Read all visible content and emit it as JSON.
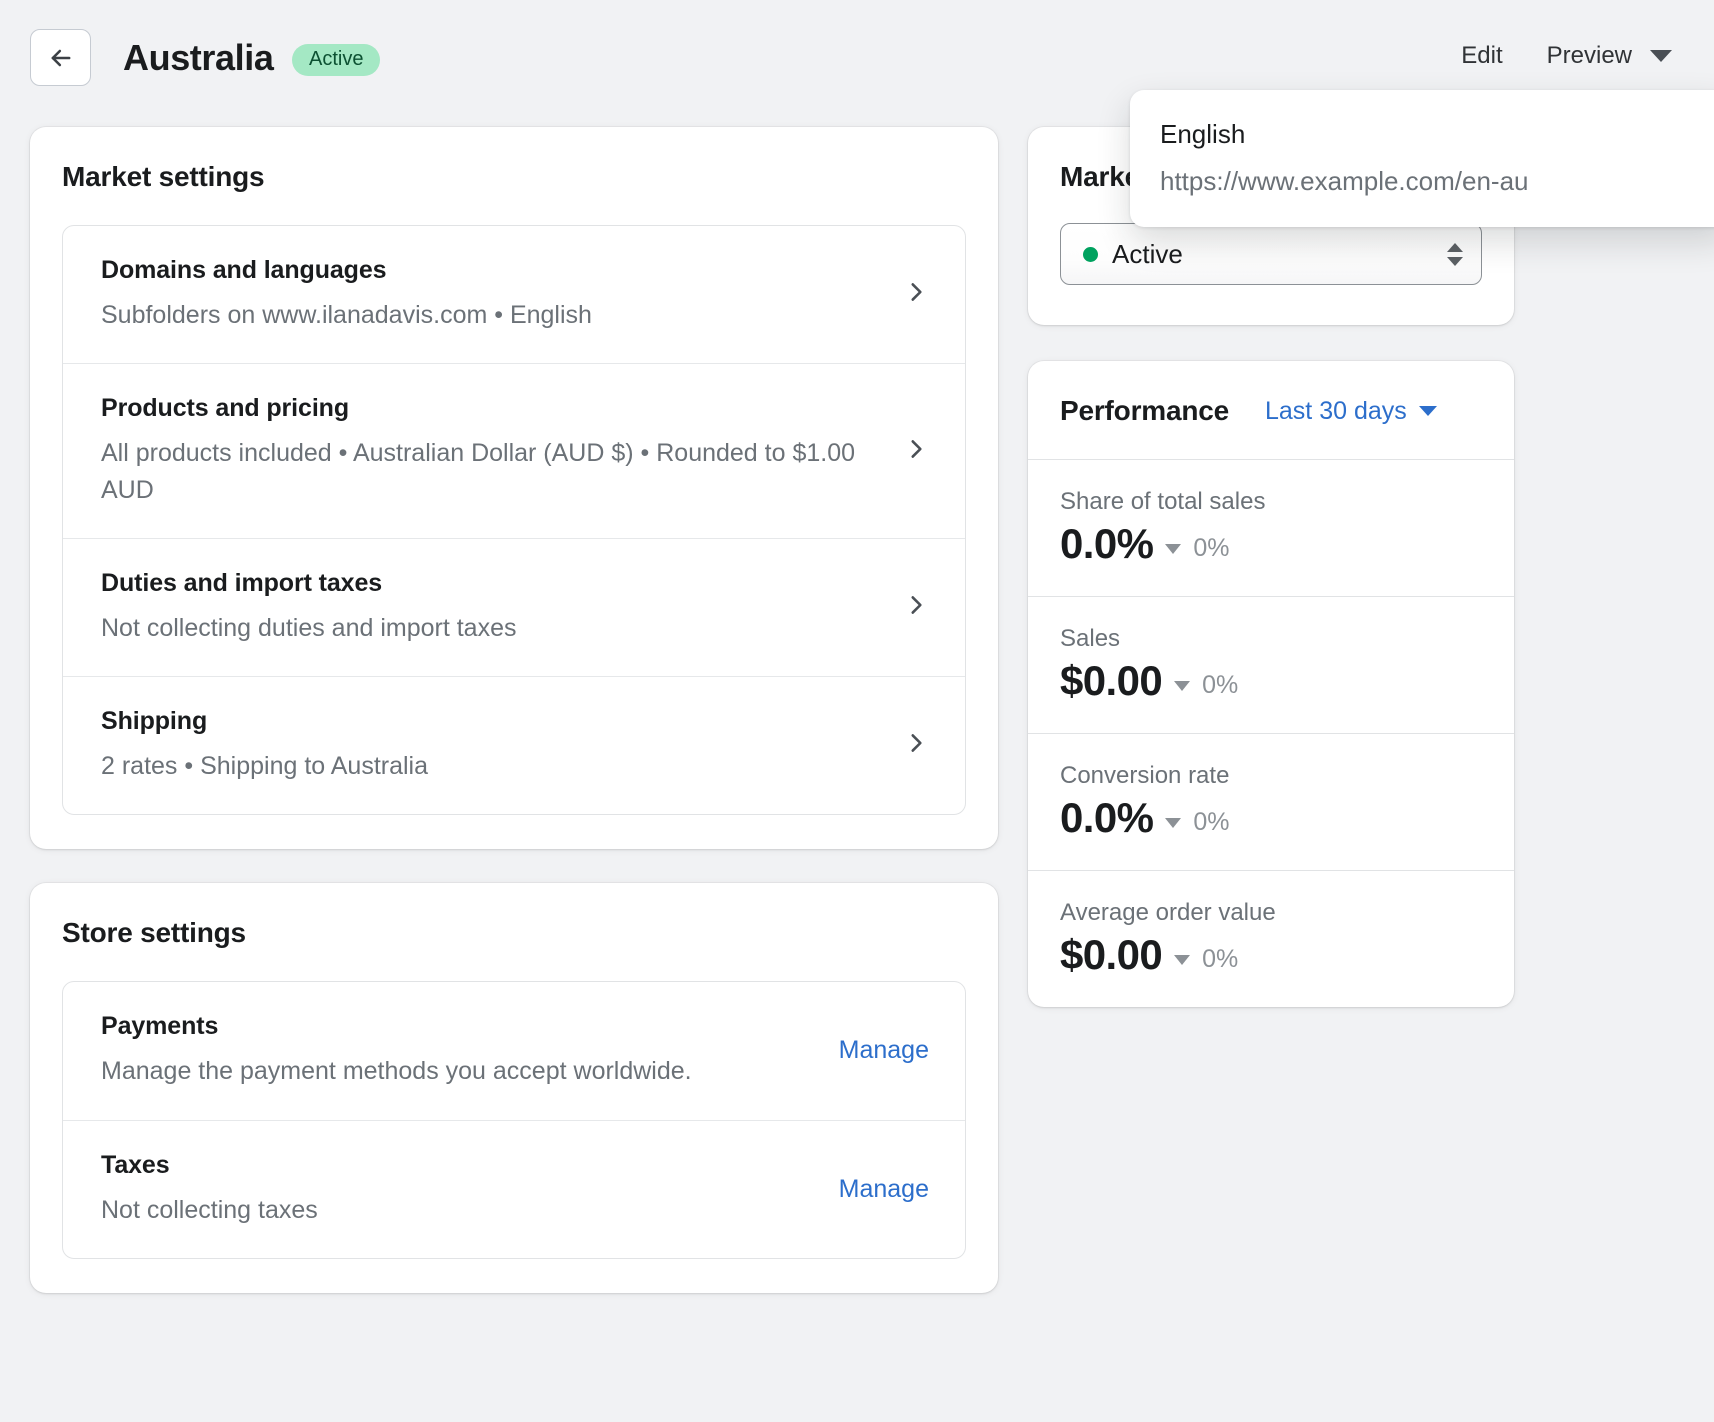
{
  "header": {
    "back_icon": "arrow-left-icon",
    "title": "Australia",
    "status_badge": "Active",
    "edit_label": "Edit",
    "preview_label": "Preview",
    "preview_caret_icon": "chevron-down-icon"
  },
  "preview_popover": {
    "language": "English",
    "url": "https://www.example.com/en-au"
  },
  "market_settings": {
    "title": "Market settings",
    "rows": [
      {
        "title": "Domains and languages",
        "subtitle": "Subfolders on www.ilanadavis.com • English",
        "chevron_icon": "chevron-right-icon"
      },
      {
        "title": "Products and pricing",
        "subtitle": "All products included • Australian Dollar (AUD $) • Rounded to $1.00 AUD",
        "chevron_icon": "chevron-right-icon"
      },
      {
        "title": "Duties and import taxes",
        "subtitle": "Not collecting duties and import taxes",
        "chevron_icon": "chevron-right-icon"
      },
      {
        "title": "Shipping",
        "subtitle": "2 rates • Shipping to Australia",
        "chevron_icon": "chevron-right-icon"
      }
    ]
  },
  "store_settings": {
    "title": "Store settings",
    "rows": [
      {
        "title": "Payments",
        "subtitle": "Manage the payment methods you accept worldwide.",
        "action_label": "Manage"
      },
      {
        "title": "Taxes",
        "subtitle": "Not collecting taxes",
        "action_label": "Manage"
      }
    ]
  },
  "market_status": {
    "title": "Market status",
    "select_value": "Active",
    "dot_color": "#00a25f",
    "stepper_icon": "select-stepper-icon"
  },
  "performance": {
    "title": "Performance",
    "range_label": "Last 30 days",
    "range_caret_icon": "chevron-down-icon",
    "metrics": [
      {
        "label": "Share of total sales",
        "value": "0.0%",
        "delta": "0%",
        "delta_caret_icon": "caret-down-icon",
        "has_sparkline": true
      },
      {
        "label": "Sales",
        "value": "$0.00",
        "delta": "0%",
        "delta_caret_icon": "caret-down-icon",
        "has_sparkline": true
      },
      {
        "label": "Conversion rate",
        "value": "0.0%",
        "delta": "0%",
        "delta_caret_icon": "caret-down-icon",
        "has_sparkline": false
      },
      {
        "label": "Average order value",
        "value": "$0.00",
        "delta": "0%",
        "delta_caret_icon": "caret-down-icon",
        "has_sparkline": false
      }
    ]
  },
  "colors": {
    "page_background": "#f1f2f4",
    "card_background": "#ffffff",
    "accent_link": "#2c6ecb",
    "badge_background": "#a4e8c4",
    "badge_text": "#0c5132",
    "subtle_text": "#6b7177"
  }
}
